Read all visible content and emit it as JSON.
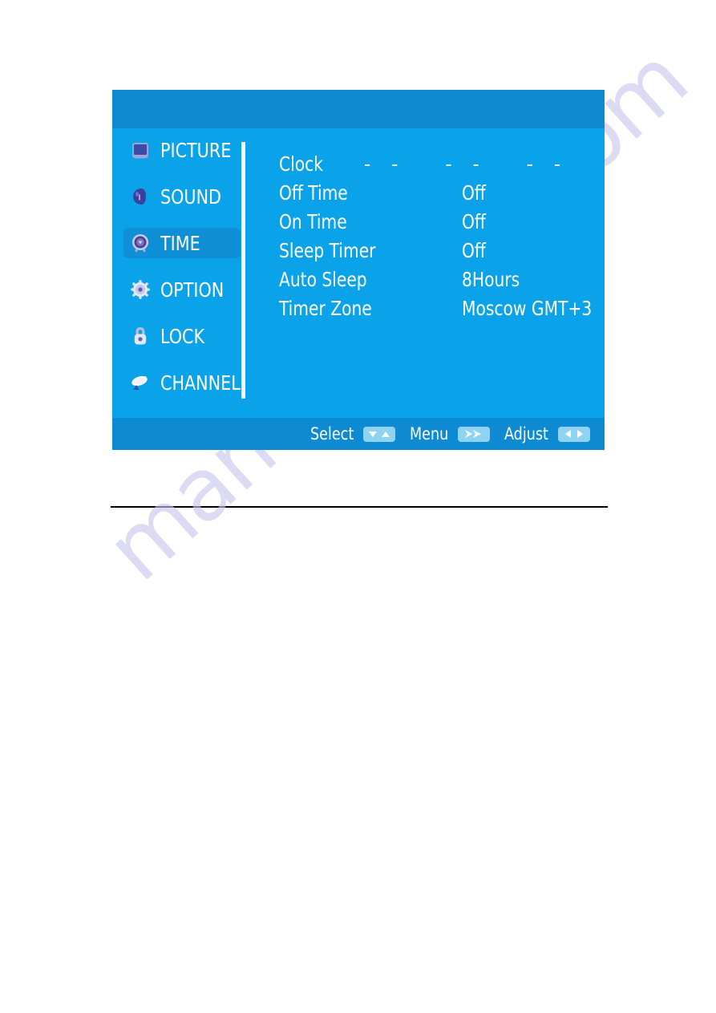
{
  "watermark": {
    "text": "manualshive.com"
  },
  "osd": {
    "accent_blue": "#0aa2e8",
    "bar_blue": "#0d8ad1",
    "highlight_blue": "#0f8fd6",
    "key_blue": "#8fd3f2",
    "sidebar": {
      "items": [
        {
          "label": "PICTURE",
          "icon": "picture-icon",
          "active": false
        },
        {
          "label": "SOUND",
          "icon": "sound-icon",
          "active": false
        },
        {
          "label": "TIME",
          "icon": "clock-icon",
          "active": true
        },
        {
          "label": "OPTION",
          "icon": "gear-icon",
          "active": false
        },
        {
          "label": "LOCK",
          "icon": "lock-icon",
          "active": false
        },
        {
          "label": "CHANNEL",
          "icon": "satellite-dish-icon",
          "active": false
        }
      ]
    },
    "settings": {
      "rows": [
        {
          "label": "Clock",
          "value": "",
          "dashes": "--  --  --"
        },
        {
          "label": "Off Time",
          "value": "Off"
        },
        {
          "label": "On Time",
          "value": "Off"
        },
        {
          "label": "Sleep Timer",
          "value": "Off"
        },
        {
          "label": "Auto Sleep",
          "value": "8Hours"
        },
        {
          "label": "Timer Zone",
          "value": "Moscow GMT+3"
        }
      ]
    },
    "footer": {
      "hints": [
        {
          "label": "Select",
          "icon": "down-up-arrows-icon"
        },
        {
          "label": "Menu",
          "icon": "double-right-arrow-icon"
        },
        {
          "label": "Adjust",
          "icon": "left-right-arrows-icon"
        }
      ]
    }
  }
}
